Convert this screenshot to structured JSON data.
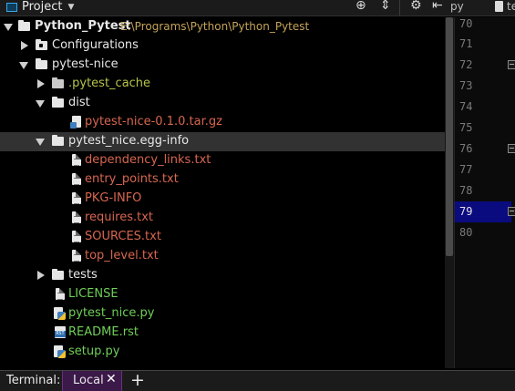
{
  "toolwindow": {
    "title": "Project",
    "buttons": [
      {
        "name": "locate",
        "glyph": "⊕"
      },
      {
        "name": "collapse",
        "glyph": "⇕"
      },
      {
        "name": "settings",
        "glyph": "⚙"
      },
      {
        "name": "hide",
        "glyph": "⇤"
      }
    ]
  },
  "editor_tabs": [
    {
      "label": "py"
    },
    {
      "label": "te"
    }
  ],
  "tree": {
    "root": {
      "name": "Python_Pytest",
      "path": "E:\\Programs\\Python\\Python_Pytest"
    },
    "items": [
      {
        "label": "Configurations"
      },
      {
        "label": "pytest-nice"
      },
      {
        "label": ".pytest_cache"
      },
      {
        "label": "dist"
      },
      {
        "label": "pytest-nice-0.1.0.tar.gz"
      },
      {
        "label": "pytest_nice.egg-info"
      },
      {
        "label": "dependency_links.txt"
      },
      {
        "label": "entry_points.txt"
      },
      {
        "label": "PKG-INFO"
      },
      {
        "label": "requires.txt"
      },
      {
        "label": "SOURCES.txt"
      },
      {
        "label": "top_level.txt"
      },
      {
        "label": "tests"
      },
      {
        "label": "LICENSE"
      },
      {
        "label": "pytest_nice.py"
      },
      {
        "label": "README.rst"
      },
      {
        "label": "setup.py"
      }
    ]
  },
  "gutter": {
    "lines": [
      "70",
      "71",
      "72",
      "73",
      "74",
      "75",
      "76",
      "77",
      "78",
      "79",
      "80"
    ],
    "current_line": "79"
  },
  "terminal": {
    "label": "Terminal:",
    "tab": "Local",
    "close_glyph": "✕",
    "add_glyph": "+"
  },
  "colors": {
    "selected_row": "#323232",
    "current_line": "#0b0b80",
    "terminal_tab": "#3b1948",
    "untracked_file": "#d7664f",
    "new_file": "#6fcf57"
  }
}
